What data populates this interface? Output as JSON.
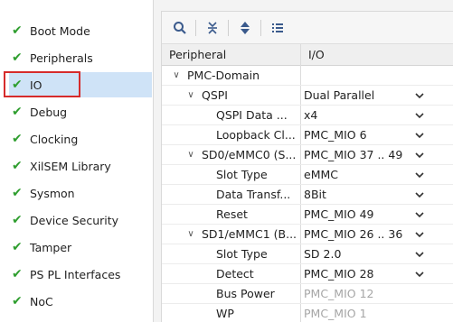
{
  "nav": {
    "items": [
      {
        "label": "Boot Mode"
      },
      {
        "label": "Peripherals"
      },
      {
        "label": "IO"
      },
      {
        "label": "Debug"
      },
      {
        "label": "Clocking"
      },
      {
        "label": "XilSEM Library"
      },
      {
        "label": "Sysmon"
      },
      {
        "label": "Device Security"
      },
      {
        "label": "Tamper"
      },
      {
        "label": "PS PL Interfaces"
      },
      {
        "label": "NoC"
      }
    ],
    "selected": "IO"
  },
  "toolbar": {
    "icons": [
      "search-icon",
      "collapse-all-icon",
      "expand-all-icon",
      "list-view-icon"
    ]
  },
  "grid": {
    "headers": {
      "peripheral": "Peripheral",
      "io": "I/O"
    },
    "rows": [
      {
        "name": "PMC-Domain",
        "value": "",
        "expand": "collapse"
      },
      {
        "name": "QSPI",
        "value": "Dual Parallel",
        "expand": "collapse"
      },
      {
        "name": "QSPI Data ...",
        "value": "x4"
      },
      {
        "name": "Loopback Cl...",
        "value": "PMC_MIO 6"
      },
      {
        "name": "SD0/eMMC0 (S...",
        "value": "PMC_MIO 37 .. 49",
        "expand": "collapse"
      },
      {
        "name": "Slot Type",
        "value": "eMMC"
      },
      {
        "name": "Data Transf...",
        "value": "8Bit"
      },
      {
        "name": "Reset",
        "value": "PMC_MIO 49"
      },
      {
        "name": "SD1/eMMC1 (B...",
        "value": "PMC_MIO 26 .. 36",
        "expand": "collapse"
      },
      {
        "name": "Slot Type",
        "value": "SD 2.0"
      },
      {
        "name": "Detect",
        "value": "PMC_MIO 28"
      },
      {
        "name": "Bus Power",
        "value": "PMC_MIO 12",
        "disabled": true
      },
      {
        "name": "WP",
        "value": "PMC_MIO 1",
        "disabled": true
      }
    ]
  },
  "colors": {
    "check": "#2f9e2f",
    "selected_bg": "#cfe3f7",
    "highlight_border": "#d62b2b",
    "toolbar_icon": "#3a5a8c"
  }
}
